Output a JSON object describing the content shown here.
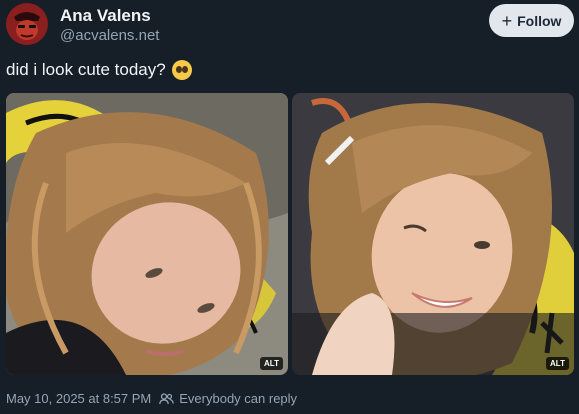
{
  "author": {
    "display_name": "Ana Valens",
    "handle": "@acvalens.net",
    "avatar_icon": "avatar-red-mask"
  },
  "follow_button": {
    "label": "Follow",
    "icon": "plus-icon"
  },
  "post": {
    "text": "did i look cute today?",
    "emoji": "pleading-face-emoji"
  },
  "images": [
    {
      "alt_badge": "ALT"
    },
    {
      "alt_badge": "ALT"
    }
  ],
  "footer": {
    "timestamp": "May 10, 2025 at 8:57 PM",
    "reply_setting": "Everybody can reply",
    "reply_icon": "people-icon"
  },
  "colors": {
    "background": "#161e27",
    "text": "#f1f3f5",
    "muted": "#93a5b7",
    "follow_bg": "#e2e7ee"
  }
}
